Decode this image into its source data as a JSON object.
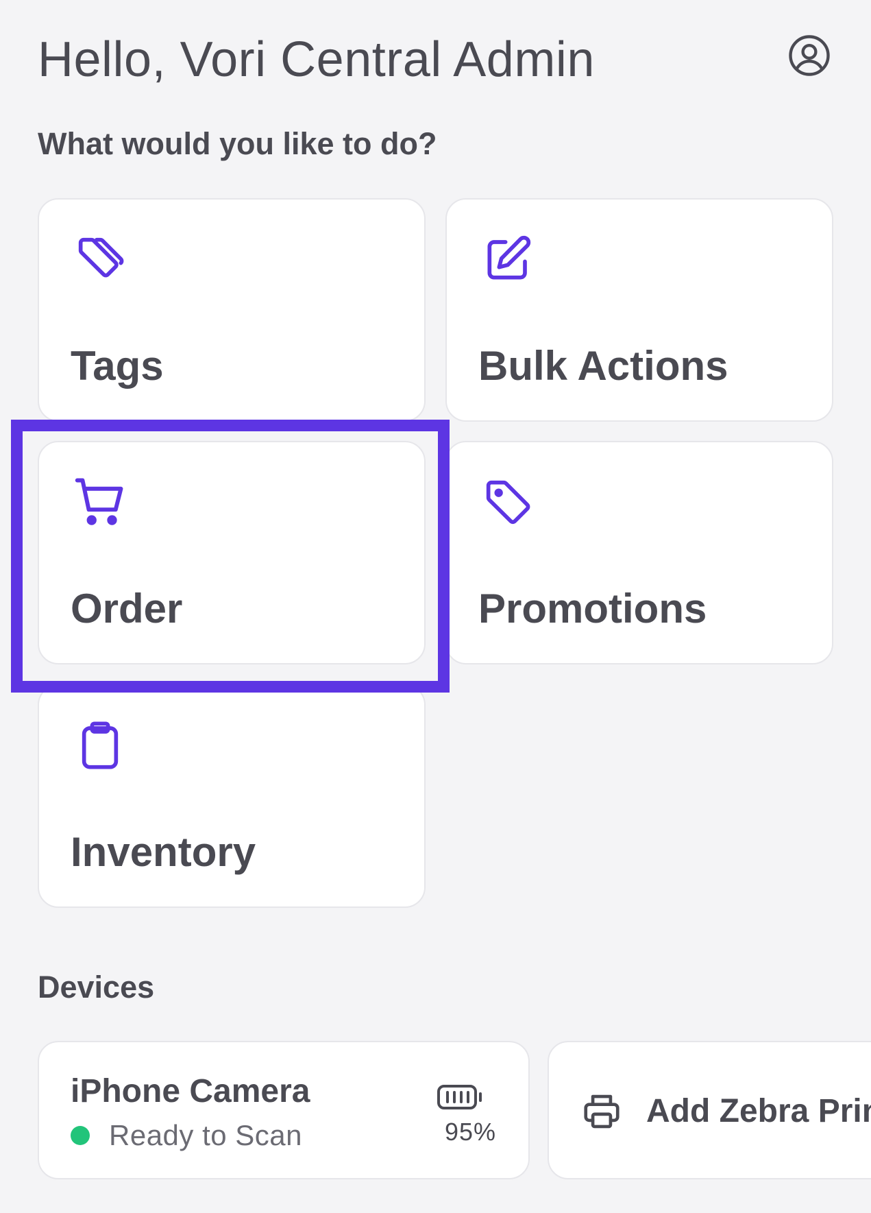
{
  "header": {
    "greeting": "Hello, Vori Central Admin",
    "profile_icon": "user-circle-icon"
  },
  "prompt": "What would you like to do?",
  "accent_color": "#5d35e3",
  "actions": [
    {
      "label": "Tags",
      "icon": "tags-icon"
    },
    {
      "label": "Bulk Actions",
      "icon": "edit-icon"
    },
    {
      "label": "Order",
      "icon": "cart-icon",
      "highlighted": true
    },
    {
      "label": "Promotions",
      "icon": "tag-icon"
    },
    {
      "label": "Inventory",
      "icon": "clipboard-icon"
    }
  ],
  "devices": {
    "title": "Devices",
    "camera": {
      "name": "iPhone Camera",
      "status": "Ready to Scan",
      "status_color": "#22c47a",
      "battery_icon": "battery-icon",
      "battery": "95%"
    },
    "add_printer": {
      "label": "Add Zebra Printer",
      "icon": "printer-icon"
    }
  }
}
